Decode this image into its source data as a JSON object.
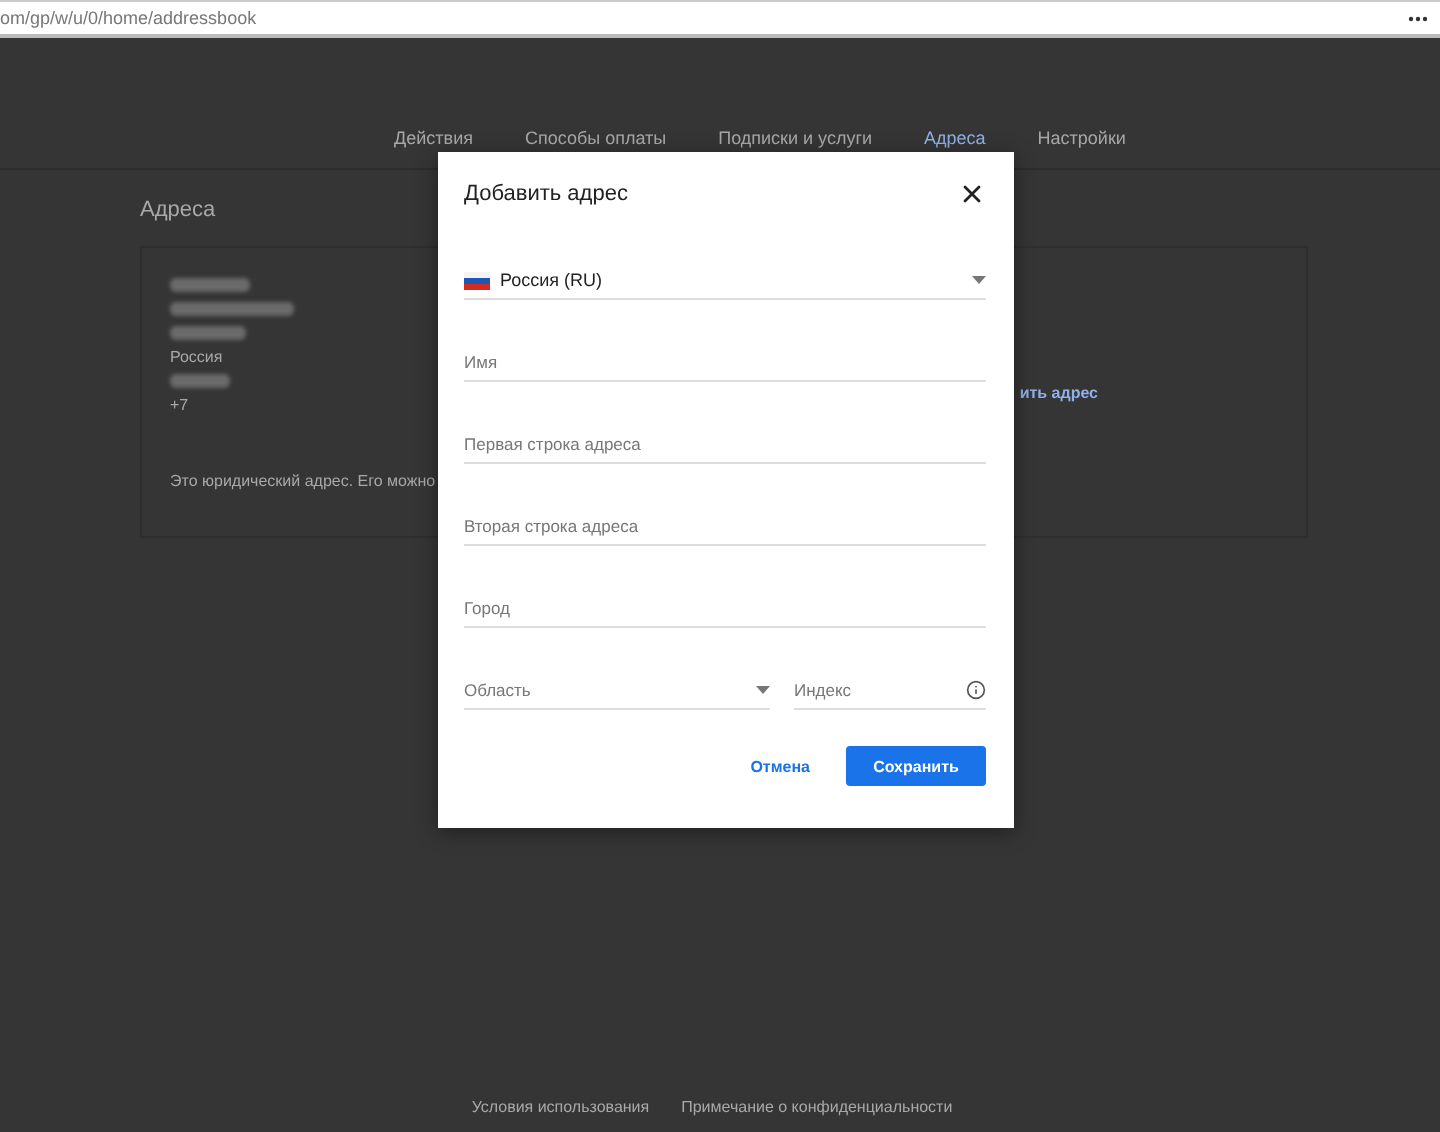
{
  "address_bar": {
    "url": "om/gp/w/u/0/home/addressbook"
  },
  "nav": [
    {
      "label": "Действия",
      "selected": false
    },
    {
      "label": "Способы оплаты",
      "selected": false
    },
    {
      "label": "Подписки и услуги",
      "selected": false
    },
    {
      "label": "Адреса",
      "selected": true
    },
    {
      "label": "Настройки",
      "selected": false
    }
  ],
  "page": {
    "title": "Адреса",
    "address_lines": [
      {
        "kind": "blurred"
      },
      {
        "kind": "blurred"
      },
      {
        "kind": "blurred"
      },
      {
        "kind": "text",
        "text": "Россия"
      },
      {
        "kind": "blurred"
      },
      {
        "kind": "text",
        "text": "+7"
      }
    ],
    "note": "Это юридический адрес. Его можно",
    "add_link": "ить адрес"
  },
  "dialog": {
    "title": "Добавить адрес",
    "country": {
      "value": "Россия (RU)"
    },
    "fields": [
      {
        "placeholder": "Имя"
      },
      {
        "placeholder": "Первая строка адреса"
      },
      {
        "placeholder": "Вторая строка адреса"
      },
      {
        "placeholder": "Город"
      }
    ],
    "region": {
      "placeholder": "Область"
    },
    "postal": {
      "placeholder": "Индекс"
    },
    "buttons": [
      {
        "label": "Отмена",
        "kind": "text"
      },
      {
        "label": "Сохранить",
        "kind": "primary"
      }
    ]
  },
  "footer": [
    "Условия использования",
    "Примечание о конфиденциальности"
  ]
}
